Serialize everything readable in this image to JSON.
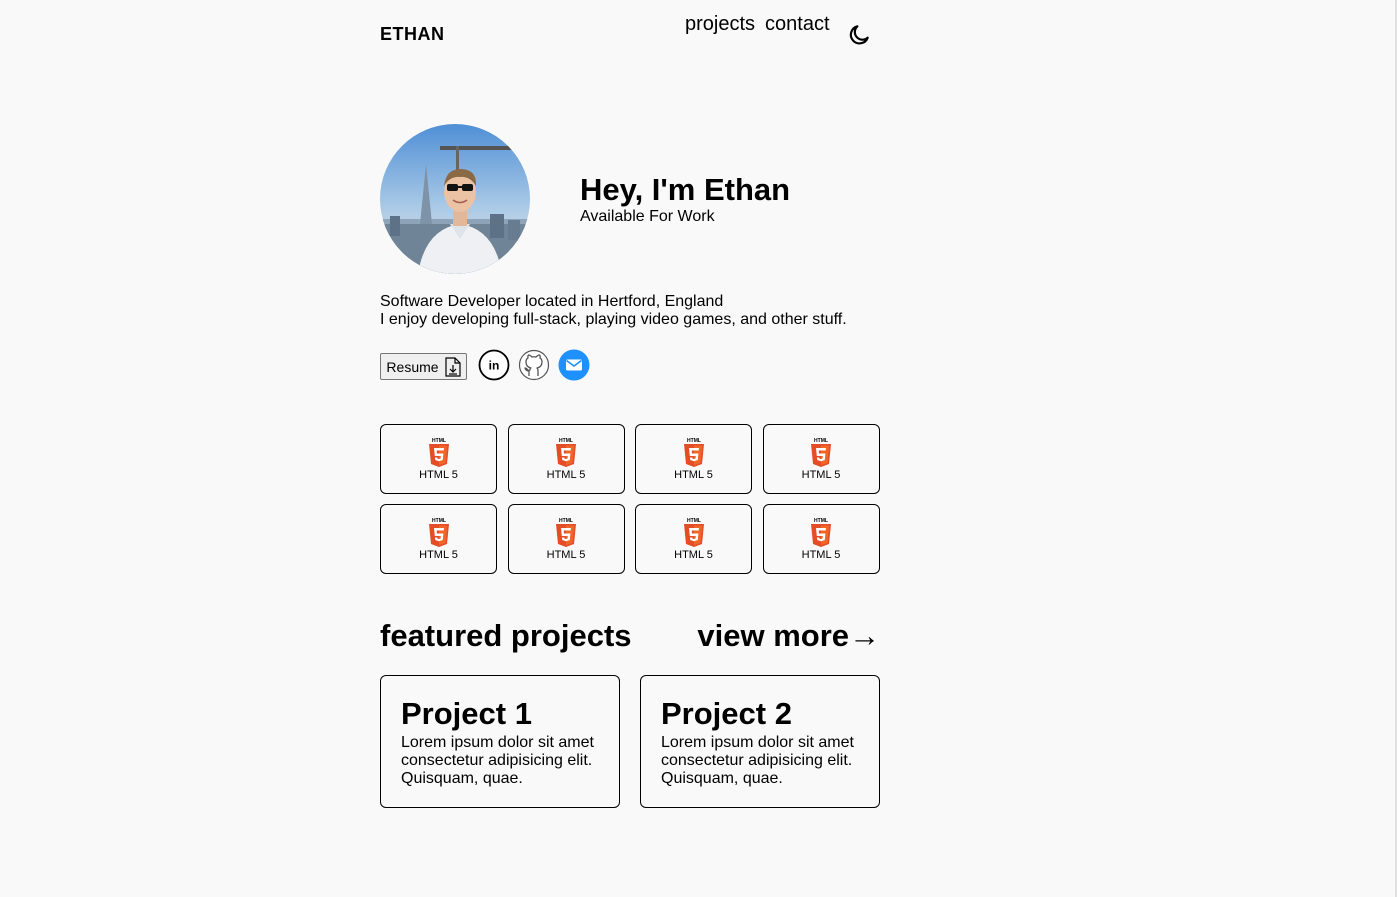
{
  "header": {
    "logo": "ETHAN",
    "nav": [
      {
        "label": "projects"
      },
      {
        "label": "contact"
      }
    ],
    "theme_toggle_icon": "moon-icon"
  },
  "hero": {
    "title": "Hey, I'm Ethan",
    "subtitle": "Available For Work",
    "bio_line1": "Software Developer located in Hertford, England",
    "bio_line2": "I enjoy developing full-stack, playing video games, and other stuff."
  },
  "socials": {
    "resume_label": "Resume",
    "links": [
      {
        "name": "linkedin",
        "icon": "linkedin-icon"
      },
      {
        "name": "github",
        "icon": "github-icon"
      },
      {
        "name": "email",
        "icon": "mail-icon",
        "color": "#1e90ff"
      }
    ]
  },
  "skills": [
    {
      "label": "HTML 5",
      "icon": "html5-icon"
    },
    {
      "label": "HTML 5",
      "icon": "html5-icon"
    },
    {
      "label": "HTML 5",
      "icon": "html5-icon"
    },
    {
      "label": "HTML 5",
      "icon": "html5-icon"
    },
    {
      "label": "HTML 5",
      "icon": "html5-icon"
    },
    {
      "label": "HTML 5",
      "icon": "html5-icon"
    },
    {
      "label": "HTML 5",
      "icon": "html5-icon"
    },
    {
      "label": "HTML 5",
      "icon": "html5-icon"
    }
  ],
  "featured": {
    "title": "featured projects",
    "view_more": "view more→",
    "projects": [
      {
        "title": "Project 1",
        "description": "Lorem ipsum dolor sit amet consectetur adipisicing elit. Quisquam, quae."
      },
      {
        "title": "Project 2",
        "description": "Lorem ipsum dolor sit amet consectetur adipisicing elit. Quisquam, quae."
      }
    ]
  },
  "colors": {
    "background": "#f9f9f9",
    "html5_orange": "#e44d26",
    "email_blue": "#1e90ff"
  }
}
